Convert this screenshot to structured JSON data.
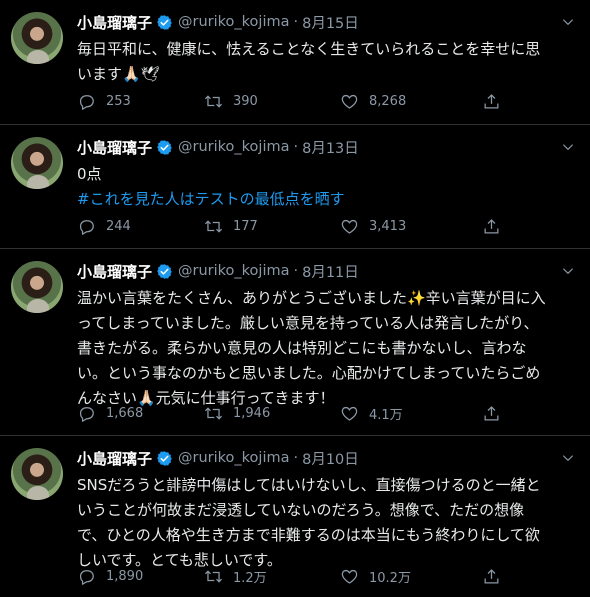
{
  "colors": {
    "background": "#000000",
    "text": "#e7e9ea",
    "muted": "#8b98a5",
    "accent": "#1d9bf0",
    "divider": "#2f3336"
  },
  "icons": {
    "reply": "speech-bubble-icon",
    "retweet": "retweet-arrows-icon",
    "like": "heart-icon",
    "share": "share-upload-icon",
    "menu": "chevron-down-icon",
    "verified": "verified-badge-icon"
  },
  "tweets": [
    {
      "name": "小島瑠璃子",
      "handle": "@ruriko_kojima",
      "separator": "·",
      "date": "8月15日",
      "lines": [
        "毎日平和に、健康に、怯えることなく生きていられることを幸せに思",
        "います🙏🏻🕊"
      ],
      "hashtag": "",
      "replies": "253",
      "retweets": "390",
      "likes": "8,268"
    },
    {
      "name": "小島瑠璃子",
      "handle": "@ruriko_kojima",
      "separator": "·",
      "date": "8月13日",
      "lines": [
        "0点"
      ],
      "hashtag": "#これを見た人はテストの最低点を晒す",
      "replies": "244",
      "retweets": "177",
      "likes": "3,413"
    },
    {
      "name": "小島瑠璃子",
      "handle": "@ruriko_kojima",
      "separator": "·",
      "date": "8月11日",
      "lines": [
        "温かい言葉をたくさん、ありがとうございました✨辛い言葉が目に入",
        "ってしまっていました。厳しい意見を持っている人は発言したがり、",
        "書きたがる。柔らかい意見の人は特別どこにも書かないし、言わな",
        "い。という事なのかもと思いました。心配かけてしまっていたらごめ",
        "んなさい🙏🏻元気に仕事行ってきます！"
      ],
      "hashtag": "",
      "replies": "1,668",
      "retweets": "1,946",
      "likes": "4.1万"
    },
    {
      "name": "小島瑠璃子",
      "handle": "@ruriko_kojima",
      "separator": "·",
      "date": "8月10日",
      "lines": [
        "SNSだろうと誹謗中傷はしてはいけないし、直接傷つけるのと一緒と",
        "いうことが何故まだ浸透していないのだろう。想像で、ただの想像",
        "で、ひとの人格や生き方まで非難するのは本当にもう終わりにして欲",
        "しいです。とても悲しいです。"
      ],
      "hashtag": "",
      "replies": "1,890",
      "retweets": "1.2万",
      "likes": "10.2万"
    }
  ]
}
